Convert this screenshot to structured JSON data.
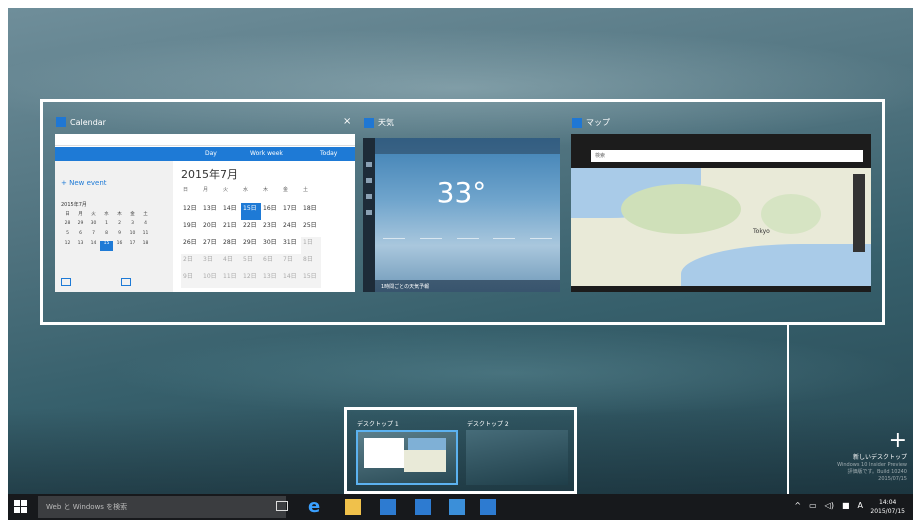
{
  "windows": {
    "calendar": {
      "title": "Calendar",
      "new_event": "+ New event",
      "mini_month": "2015年7月",
      "month_title": "2015年7月",
      "mini_dow": [
        "日",
        "月",
        "火",
        "水",
        "木",
        "金",
        "土"
      ],
      "mini_days": [
        "28",
        "29",
        "30",
        "1",
        "2",
        "3",
        "4",
        "5",
        "6",
        "7",
        "8",
        "9",
        "10",
        "11",
        "12",
        "13",
        "14",
        "15",
        "16",
        "17",
        "18"
      ],
      "big_dow": [
        "日",
        "月",
        "火",
        "水",
        "木",
        "金",
        "土"
      ],
      "big_days": [
        "12日",
        "13日",
        "14日",
        "15日",
        "16日",
        "17日",
        "18日",
        "19日",
        "20日",
        "21日",
        "22日",
        "23日",
        "24日",
        "25日",
        "26日",
        "27日",
        "28日",
        "29日",
        "30日",
        "31日",
        "1日",
        "2日",
        "3日",
        "4日",
        "5日",
        "6日",
        "7日",
        "8日",
        "9日",
        "10日",
        "11日",
        "12日",
        "13日",
        "14日",
        "15日"
      ],
      "toolbar": [
        "Day",
        "Work week",
        "Today"
      ]
    },
    "weather": {
      "title": "天気",
      "temp": "33°",
      "bottom": "1時間ごとの天気予報"
    },
    "map": {
      "title": "マップ",
      "search_placeholder": "検索",
      "label_tokyo": "Tokyo"
    }
  },
  "virtual_desktops": {
    "desktop1": "デスクトップ 1",
    "desktop2": "デスクトップ 2",
    "new_desktop": "新しいデスクトップ"
  },
  "watermark": [
    "Windows 10 Insider Preview",
    "評価版です。Build 10240",
    "2015/07/15"
  ],
  "taskbar": {
    "search_placeholder": "Web と Windows を検索",
    "time": "14:04",
    "date": "2015/07/15",
    "ime": "A"
  }
}
